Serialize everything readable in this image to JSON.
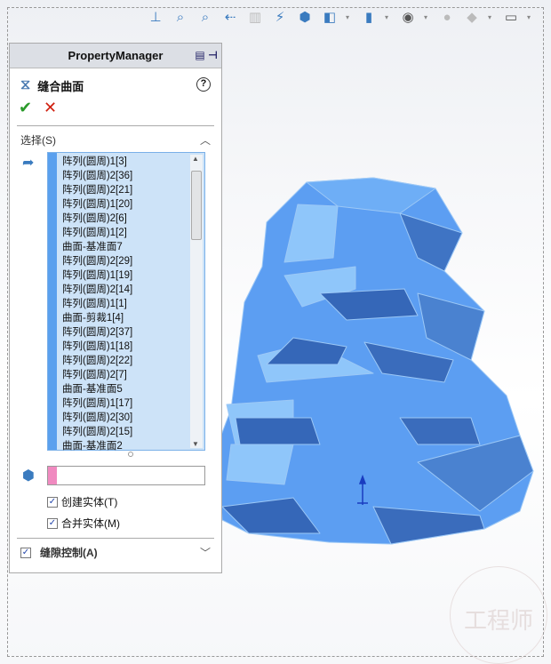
{
  "toolbar": {
    "icons": [
      "view-orientation-icon",
      "zoom-to-fit-icon",
      "zoom-to-area-icon",
      "previous-view-icon",
      "section-view-icon",
      "dynamic-annotation-icon",
      "view-orientation-cube-icon",
      "display-style-icon",
      "hide-show-icon",
      "edit-appearance-icon",
      "apply-scene-icon",
      "view-settings-icon"
    ]
  },
  "pm": {
    "title": "PropertyManager",
    "feature": "缝合曲面",
    "help": "?",
    "ok": "✔",
    "cancel": "✕",
    "selection_label": "选择(S)",
    "items": [
      "阵列(圆周)1[3]",
      "阵列(圆周)2[36]",
      "阵列(圆周)2[21]",
      "阵列(圆周)1[20]",
      "阵列(圆周)2[6]",
      "阵列(圆周)1[2]",
      "曲面-基准面7",
      "阵列(圆周)2[29]",
      "阵列(圆周)1[19]",
      "阵列(圆周)2[14]",
      "阵列(圆周)1[1]",
      "曲面-剪裁1[4]",
      "阵列(圆周)2[37]",
      "阵列(圆周)1[18]",
      "阵列(圆周)2[22]",
      "阵列(圆周)2[7]",
      "曲面-基准面5",
      "阵列(圆周)1[17]",
      "阵列(圆周)2[30]",
      "阵列(圆周)2[15]",
      "曲面-基准面2"
    ],
    "body_value": "",
    "create_solid": {
      "label": "创建实体(T)",
      "checked": true
    },
    "merge_solid": {
      "label": "合并实体(M)",
      "checked": true
    },
    "gap_control": {
      "label": "缝隙控制(A)",
      "checked": true
    }
  },
  "colors": {
    "model": "#5c9ef2",
    "model_light": "#8fc6fa",
    "model_dark": "#3567b8",
    "annotation": "#e00000"
  },
  "watermark": "工程师"
}
